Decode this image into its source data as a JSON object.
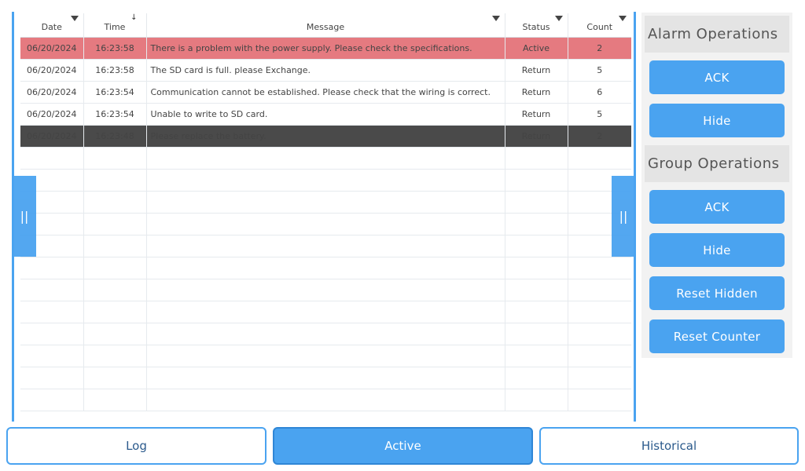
{
  "table": {
    "columns": [
      {
        "key": "date",
        "label": "Date",
        "indicator": "dropdown-triangle"
      },
      {
        "key": "time",
        "label": "Time",
        "indicator": "sort-down-arrow"
      },
      {
        "key": "message",
        "label": "Message",
        "indicator": "dropdown-triangle"
      },
      {
        "key": "status",
        "label": "Status",
        "indicator": "dropdown-triangle"
      },
      {
        "key": "count",
        "label": "Count",
        "indicator": "dropdown-triangle"
      }
    ],
    "rows": [
      {
        "date": "06/20/2024",
        "time": "16:23:58",
        "message": "There is a problem with the power supply. Please check the specifications.",
        "status": "Active",
        "count": "2",
        "state": "active"
      },
      {
        "date": "06/20/2024",
        "time": "16:23:58",
        "message": "The SD card is full. please Exchange.",
        "status": "Return",
        "count": "5",
        "state": "normal"
      },
      {
        "date": "06/20/2024",
        "time": "16:23:54",
        "message": "Communication cannot be established. Please check that the wiring is correct.",
        "status": "Return",
        "count": "6",
        "state": "normal"
      },
      {
        "date": "06/20/2024",
        "time": "16:23:54",
        "message": "Unable to write to SD card.",
        "status": "Return",
        "count": "5",
        "state": "normal"
      },
      {
        "date": "06/20/2024",
        "time": "16:23:48",
        "message": "Please replace the battery.",
        "status": "Return",
        "count": "2",
        "state": "selected"
      }
    ],
    "empty_rows": 12,
    "left_handle": "||",
    "right_handle": "||"
  },
  "alarm_operations": {
    "title": "Alarm Operations",
    "ack_label": "ACK",
    "hide_label": "Hide"
  },
  "group_operations": {
    "title": "Group Operations",
    "ack_label": "ACK",
    "hide_label": "Hide",
    "reset_hidden_label": "Reset Hidden",
    "reset_counter_label": "Reset Counter"
  },
  "tabs": {
    "log_label": "Log",
    "active_label": "Active",
    "historical_label": "Historical",
    "selected": "active"
  },
  "colors": {
    "accent": "#4aa3f0",
    "active_row": "#e57a80",
    "selected_row": "#4a4a4a",
    "panel_bg": "#f2f2f2"
  }
}
